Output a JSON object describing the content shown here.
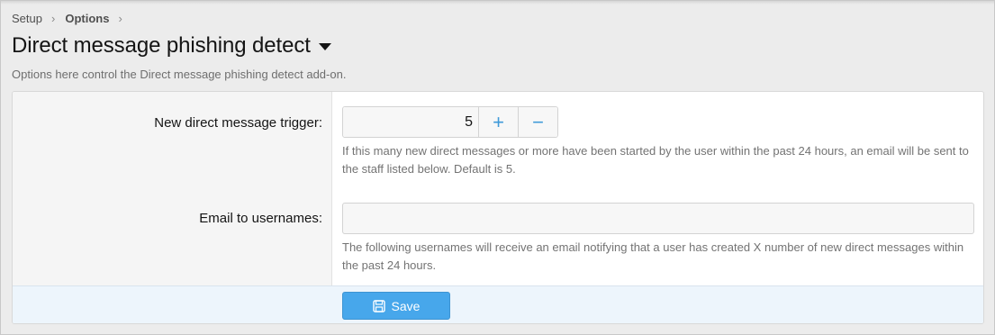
{
  "breadcrumb": {
    "items": [
      "Setup",
      "Options"
    ]
  },
  "page": {
    "title": "Direct message phishing detect",
    "description": "Options here control the Direct message phishing detect add-on."
  },
  "options": {
    "trigger": {
      "label": "New direct message trigger:",
      "value": "5",
      "increment_symbol": "+",
      "decrement_symbol": "−",
      "hint": "If this many new direct messages or more have been started by the user within the past 24 hours, an email will be sent to the staff listed below. Default is 5."
    },
    "email": {
      "label": "Email to usernames:",
      "value": "",
      "placeholder": "",
      "hint": "The following usernames will receive an email notifying that a user has created X number of new direct messages within the past 24 hours."
    }
  },
  "footer": {
    "save_label": "Save",
    "save_icon": "save-icon"
  },
  "colors": {
    "accent": "#47a7eb",
    "stepper_symbol": "#3f9ad8",
    "footer_bg": "#edf5fc"
  }
}
